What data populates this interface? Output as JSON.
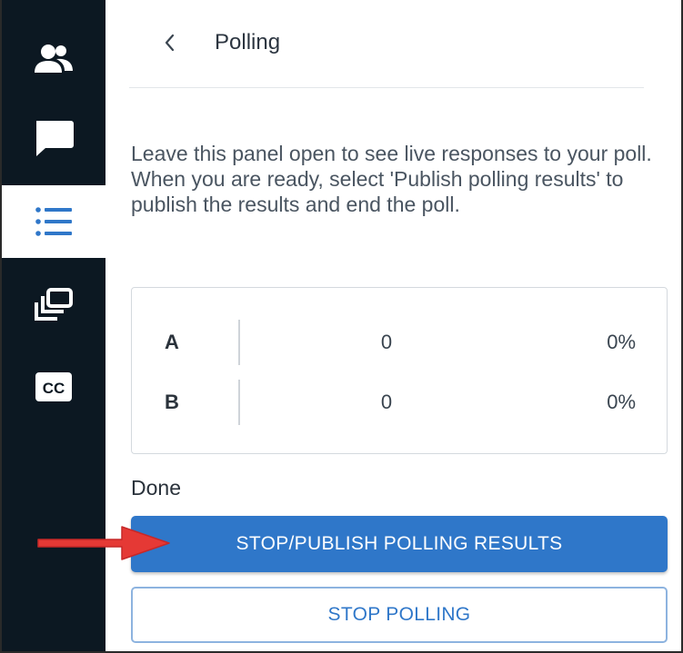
{
  "sidebar": {
    "items": [
      {
        "icon": "users-icon",
        "active": false
      },
      {
        "icon": "chat-icon",
        "active": false
      },
      {
        "icon": "list-icon",
        "active": true
      },
      {
        "icon": "screenshare-icon",
        "active": false
      },
      {
        "icon": "closed-captions-icon",
        "active": false
      }
    ]
  },
  "panel": {
    "title": "Polling",
    "instructions": "Leave this panel open to see live responses to your poll. When you are ready, select 'Publish polling results' to publish the results and end the poll.",
    "results": [
      {
        "option": "A",
        "count": "0",
        "percent": "0%"
      },
      {
        "option": "B",
        "count": "0",
        "percent": "0%"
      }
    ],
    "status": "Done",
    "publish_label": "STOP/PUBLISH POLLING RESULTS",
    "stop_label": "STOP POLLING"
  },
  "colors": {
    "sidebar_bg": "#0c1822",
    "accent": "#2f77c9",
    "annotation_arrow": "#e53935"
  }
}
